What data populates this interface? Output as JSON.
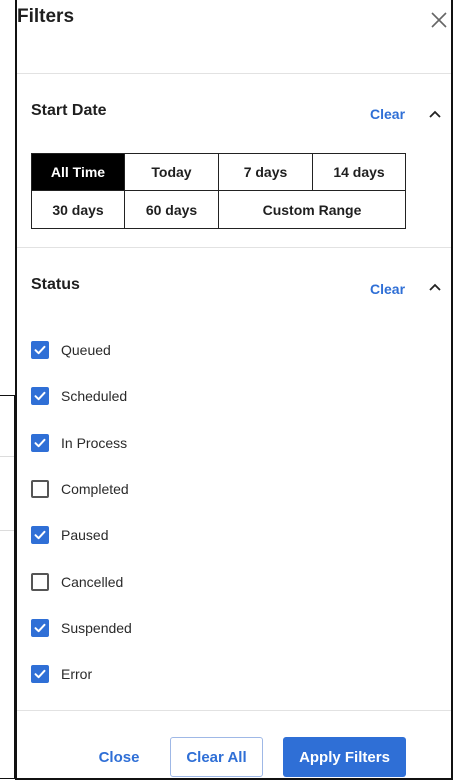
{
  "panel": {
    "title": "Filters"
  },
  "start_date": {
    "title": "Start Date",
    "clear_label": "Clear",
    "options": [
      "All Time",
      "Today",
      "7 days",
      "14 days",
      "30 days",
      "60 days",
      "Custom Range"
    ],
    "selected": "All Time"
  },
  "status": {
    "title": "Status",
    "clear_label": "Clear",
    "items": [
      {
        "label": "Queued",
        "checked": true
      },
      {
        "label": "Scheduled",
        "checked": true
      },
      {
        "label": "In Process",
        "checked": true
      },
      {
        "label": "Completed",
        "checked": false
      },
      {
        "label": "Paused",
        "checked": true
      },
      {
        "label": "Cancelled",
        "checked": false
      },
      {
        "label": "Suspended",
        "checked": true
      },
      {
        "label": "Error",
        "checked": true
      }
    ]
  },
  "footer": {
    "close_label": "Close",
    "clear_all_label": "Clear All",
    "apply_label": "Apply Filters"
  },
  "colors": {
    "accent": "#2f6fd6",
    "selected_bg": "#000000"
  },
  "icons": {
    "close": "close-icon",
    "collapse": "chevron-up-icon",
    "check": "check-icon"
  }
}
